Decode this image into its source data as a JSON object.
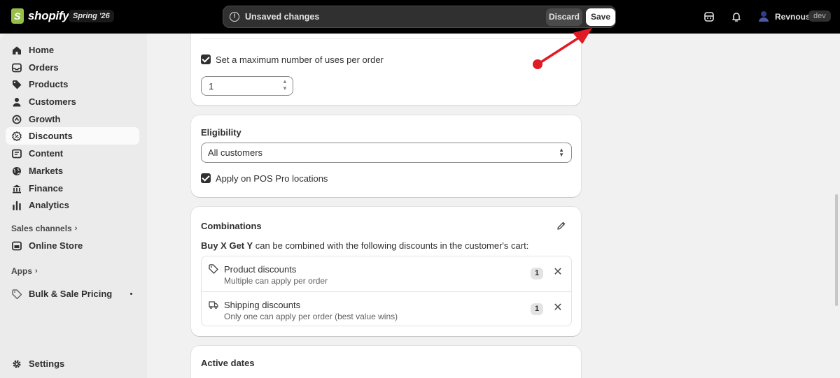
{
  "topbar": {
    "logo_text": "shopify",
    "edition": "Spring '26",
    "unsaved_text": "Unsaved changes",
    "discard_label": "Discard",
    "save_label": "Save",
    "user_name": "Revnous",
    "user_badge": "dev"
  },
  "sidebar": {
    "items": [
      {
        "label": "Home",
        "icon": "home-icon"
      },
      {
        "label": "Orders",
        "icon": "orders-icon"
      },
      {
        "label": "Products",
        "icon": "tag-icon"
      },
      {
        "label": "Customers",
        "icon": "person-icon"
      },
      {
        "label": "Growth",
        "icon": "growth-icon"
      },
      {
        "label": "Discounts",
        "icon": "discount-icon",
        "active": true
      },
      {
        "label": "Content",
        "icon": "content-icon"
      },
      {
        "label": "Markets",
        "icon": "globe-icon"
      },
      {
        "label": "Finance",
        "icon": "bank-icon"
      },
      {
        "label": "Analytics",
        "icon": "chart-icon"
      }
    ],
    "sales_channels_label": "Sales channels",
    "online_store_label": "Online Store",
    "apps_label": "Apps",
    "app_item_label": "Bulk & Sale Pricing",
    "settings_label": "Settings"
  },
  "usage_card": {
    "max_uses_label": "Set a maximum number of uses per order",
    "max_uses_checked": true,
    "max_uses_value": "1"
  },
  "eligibility_card": {
    "title": "Eligibility",
    "select_value": "All customers",
    "pos_label": "Apply on POS Pro locations",
    "pos_checked": true
  },
  "combinations_card": {
    "title": "Combinations",
    "description_bold": "Buy X Get Y",
    "description_rest": " can be combined with the following discounts in the customer's cart:",
    "rows": [
      {
        "title": "Product discounts",
        "subtitle": "Multiple can apply per order",
        "count": "1",
        "icon": "tag-icon"
      },
      {
        "title": "Shipping discounts",
        "subtitle": "Only one can apply per order (best value wins)",
        "count": "1",
        "icon": "truck-icon"
      }
    ]
  },
  "active_dates_card": {
    "title": "Active dates"
  },
  "colors": {
    "topbar": "#000000",
    "sidebar": "#ebebeb",
    "background": "#f1f1f1",
    "annotation_arrow": "#e01b24"
  }
}
